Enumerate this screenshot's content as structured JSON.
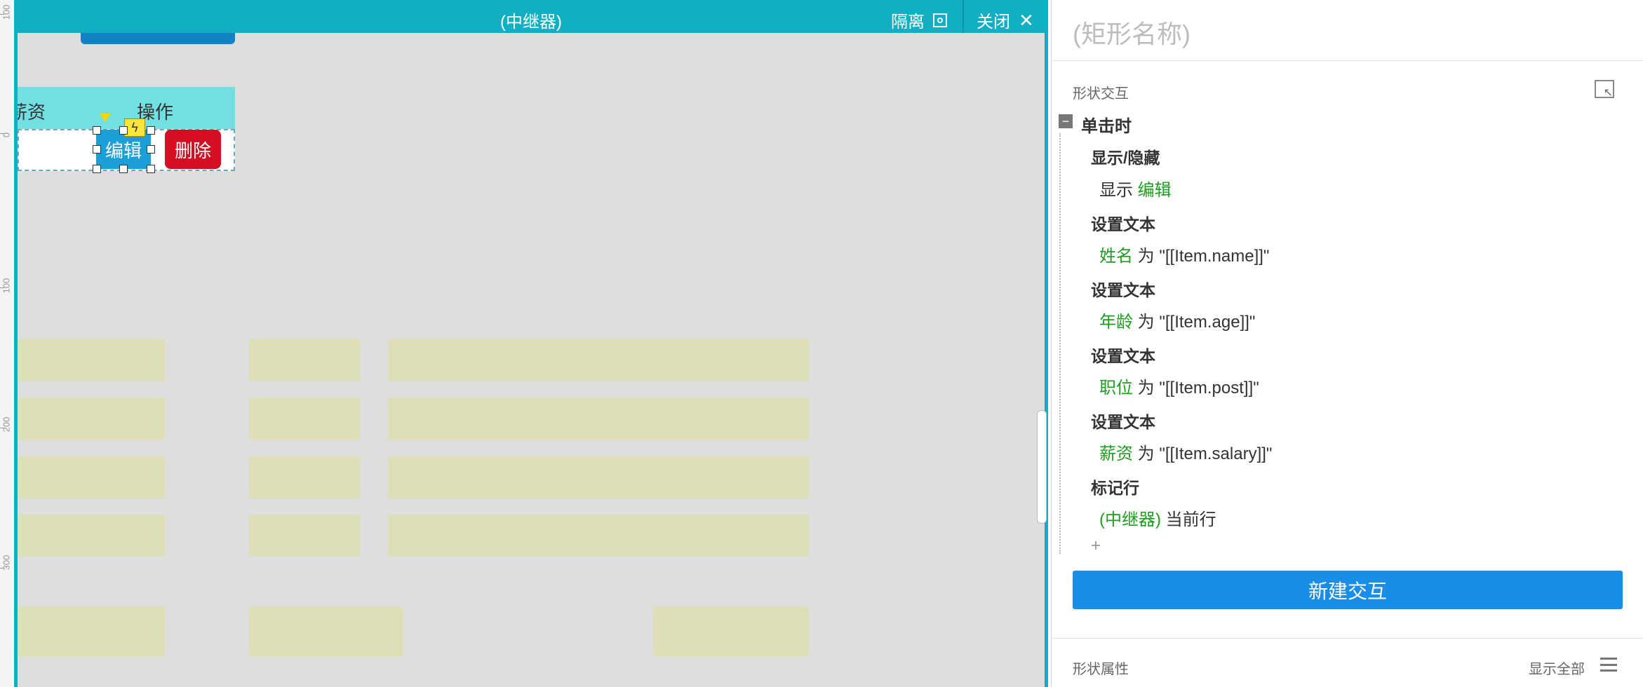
{
  "topbar": {
    "title": "(中继器)",
    "isolate_label": "隔离",
    "close_label": "关闭"
  },
  "ruler": {
    "labels": [
      "100",
      "0",
      "100",
      "200",
      "300"
    ]
  },
  "canvas": {
    "header": {
      "salary": "薪资",
      "action": "操作"
    },
    "row": {
      "edit_label": "编辑",
      "delete_label": "删除"
    }
  },
  "panel": {
    "shape_name": "(矩形名称)",
    "interactions_label": "形状交互",
    "event_label": "单击时",
    "actions": [
      {
        "title": "显示/隐藏",
        "verb": "显示",
        "target": "编辑",
        "suffix": ""
      },
      {
        "title": "设置文本",
        "target": "姓名",
        "verb": "为",
        "value": "\"[[Item.name]]\""
      },
      {
        "title": "设置文本",
        "target": "年龄",
        "verb": "为",
        "value": "\"[[Item.age]]\""
      },
      {
        "title": "设置文本",
        "target": "职位",
        "verb": "为",
        "value": "\"[[Item.post]]\""
      },
      {
        "title": "设置文本",
        "target": "薪资",
        "verb": "为",
        "value": "\"[[Item.salary]]\""
      },
      {
        "title": "标记行",
        "target": "(中继器)",
        "value": "当前行"
      }
    ],
    "add_symbol": "+",
    "new_interaction_label": "新建交互",
    "properties_label": "形状属性",
    "show_all_label": "显示全部"
  },
  "colors": {
    "accent": "#10afc3",
    "edit_button": "#1aa0d6",
    "delete_button": "#d40f24",
    "new_interaction": "#1a8de6",
    "placeholder_block": "#dedfb6"
  },
  "icons": {
    "focus": "focus-icon",
    "close": "close-icon",
    "collapse": "collapse-icon",
    "corner": "popout-icon",
    "menu": "menu-icon"
  }
}
